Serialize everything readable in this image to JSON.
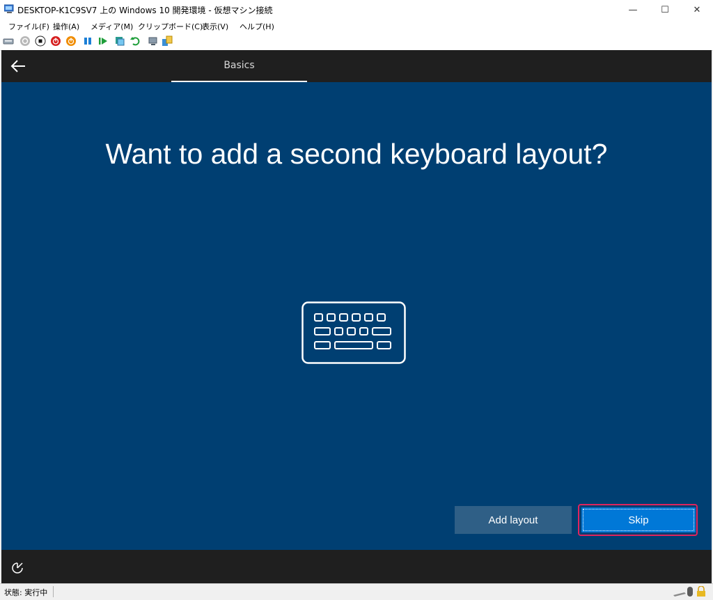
{
  "window": {
    "title": "DESKTOP-K1C9SV7 上の Windows 10 開発環境 - 仮想マシン接続",
    "minimize": "—",
    "maximize": "☐",
    "close": "✕"
  },
  "menu": {
    "items": [
      "ファイル(F)",
      "操作(A)",
      "メディア(M)",
      "クリップボード(C)",
      "表示(V)",
      "ヘルプ(H)"
    ]
  },
  "toolbar": {
    "icons": [
      "ctrl-alt-del-icon",
      "start-icon",
      "turn-off-icon",
      "shutdown-icon",
      "save-icon",
      "pause-icon",
      "resume-icon",
      "checkpoint-icon",
      "revert-icon",
      "enhanced-session-icon",
      "share-icon"
    ]
  },
  "oobe": {
    "tab": "Basics",
    "heading": "Want to add a second keyboard layout?",
    "add_layout": "Add layout",
    "skip": "Skip",
    "background": "#003f72",
    "accent": "#0078d7"
  },
  "status": {
    "text": "状態: 実行中"
  }
}
